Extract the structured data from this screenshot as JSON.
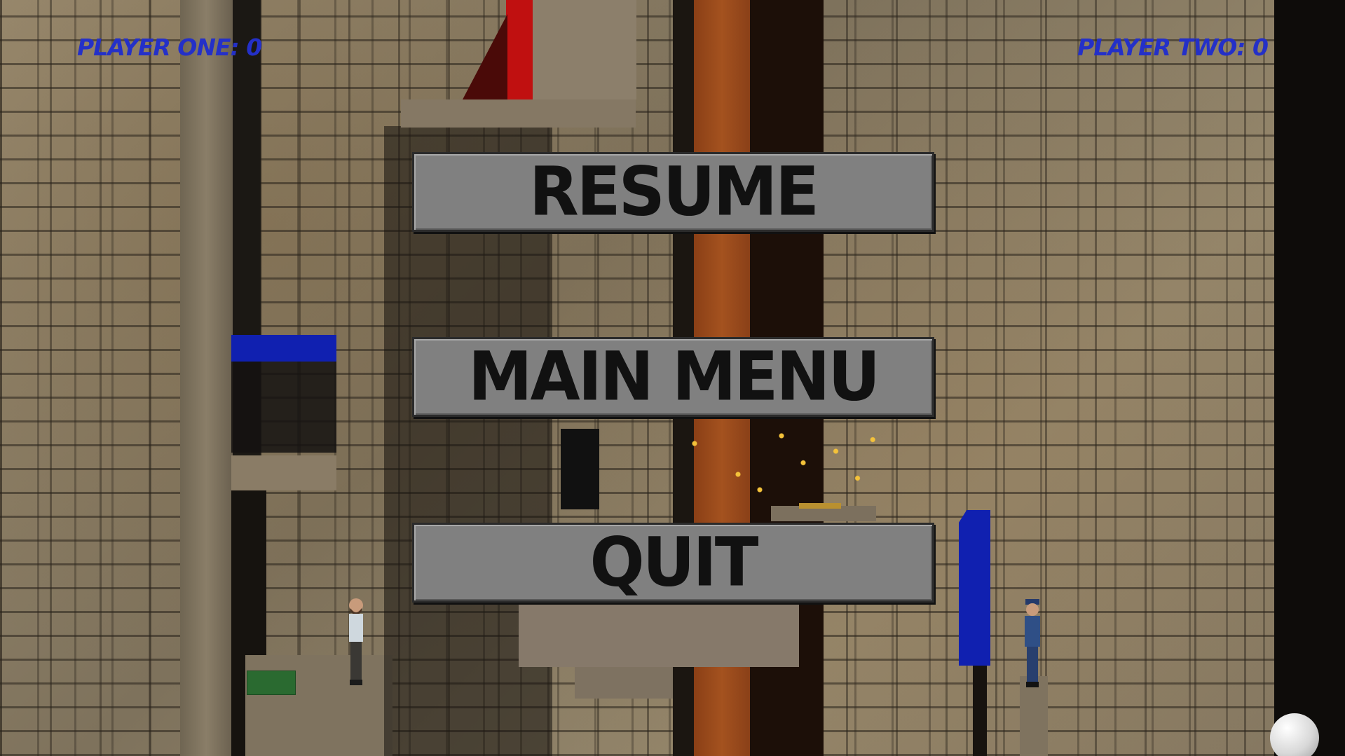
{
  "hud": {
    "player_one": "PLAYER ONE: 0",
    "player_two": "PLAYER TWO: 0"
  },
  "pause_menu": {
    "resume": "RESUME",
    "main_menu": "MAIN MENU",
    "quit": "QUIT"
  },
  "colors": {
    "hud_text": "#2430c8",
    "button_fill": "#808080",
    "button_text": "#111111",
    "platform_blue": "#1020b0",
    "platform_red": "#c01010",
    "pillar_orange": "#9a4a1c",
    "pad_green": "#2a6a30"
  },
  "icons": {
    "player_one_character": "bearded-man",
    "player_two_character": "police-officer",
    "ball": "white-sphere"
  }
}
